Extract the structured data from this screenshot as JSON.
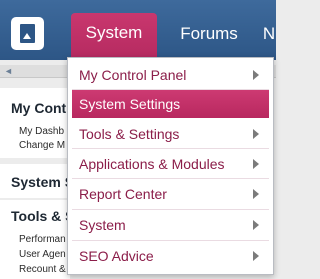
{
  "nav": {
    "tabs": [
      "System",
      "Forums",
      "N"
    ]
  },
  "page": {
    "panel1_title": "My Contr",
    "panel1_links": [
      "My Dashb",
      "Change M"
    ],
    "panel2_title": "System S",
    "panel3_title": "Tools & S",
    "panel3_links": [
      "Performan",
      "User Agen",
      "Recount & Rebuild"
    ]
  },
  "menu": {
    "items": [
      {
        "label": "My Control Panel",
        "has_submenu": true
      },
      {
        "label": "System Settings",
        "has_submenu": false
      },
      {
        "label": "Tools & Settings",
        "has_submenu": true
      },
      {
        "label": "Applications & Modules",
        "has_submenu": true
      },
      {
        "label": "Report Center",
        "has_submenu": true
      },
      {
        "label": "System",
        "has_submenu": true
      },
      {
        "label": "SEO Advice",
        "has_submenu": true
      }
    ]
  },
  "colors": {
    "topbar": "#2d5686",
    "accent": "#b52a60",
    "menu_text": "#8b1d49"
  },
  "icons": {
    "logo": "logo-icon",
    "submenu": "chevron-right-icon"
  }
}
